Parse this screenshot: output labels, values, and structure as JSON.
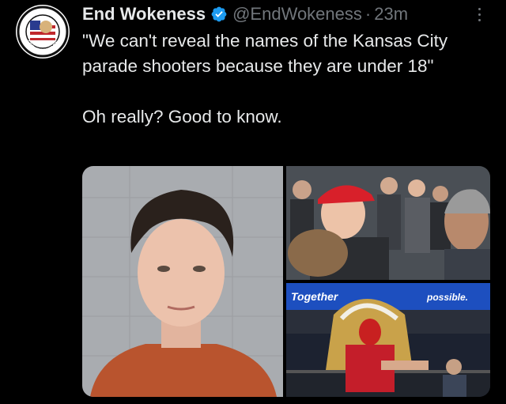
{
  "tweet": {
    "display_name": "End Wokeness",
    "handle": "@EndWokeness",
    "separator": "·",
    "timestamp": "23m",
    "verified": true,
    "verified_color": "#1d9bf0",
    "more_icon": "more-vertical-icon",
    "body_line1": "\"We can't reveal the names of the Kansas City parade shooters because they are under 18\"",
    "body_line2": "Oh really? Good to know."
  },
  "avatar": {
    "ring_text_top": "I SUPPORT THE",
    "ring_text_bottom": "FORMER THENES"
  },
  "media": {
    "left_image": "mugshot-photo",
    "top_right_image": "crowd-photo",
    "bottom_right_image": "stadium-fan-photo",
    "banner_text": "Together",
    "banner_text_right": "possible."
  },
  "colors": {
    "background": "#000000",
    "text_primary": "#e7e9ea",
    "text_secondary": "#71767b",
    "accent": "#1d9bf0"
  }
}
